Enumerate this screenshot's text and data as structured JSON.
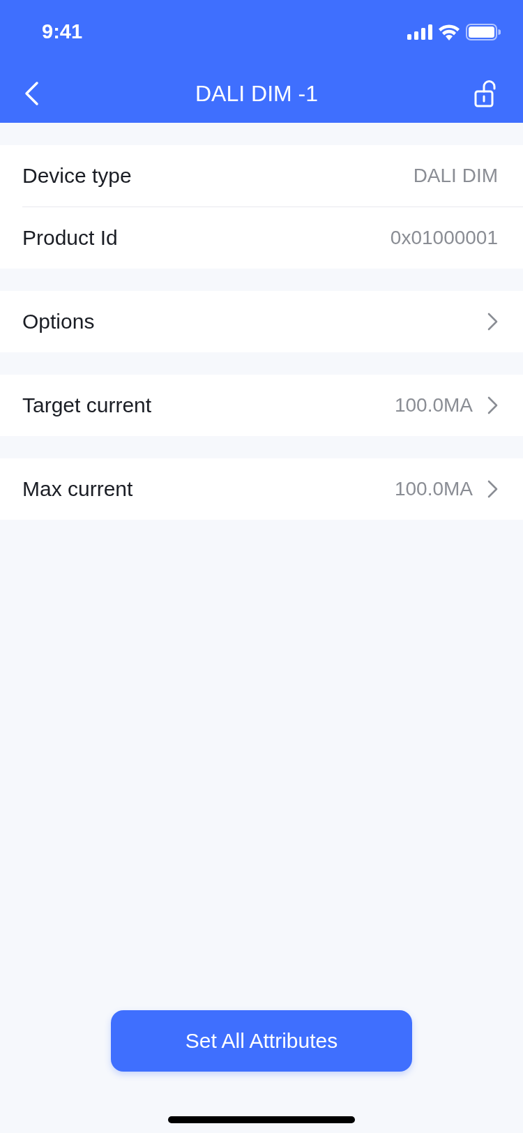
{
  "status_bar": {
    "time": "9:41"
  },
  "nav_bar": {
    "title": "DALI DIM -1"
  },
  "sections": [
    {
      "rows": [
        {
          "kind": "info",
          "label": "Device type",
          "value": "DALI DIM"
        },
        {
          "kind": "info",
          "label": "Product Id",
          "value": "0x01000001"
        }
      ]
    },
    {
      "rows": [
        {
          "kind": "nav",
          "label": "Options"
        }
      ]
    },
    {
      "rows": [
        {
          "kind": "nav",
          "label": "Target current",
          "value": "100.0MA"
        }
      ]
    },
    {
      "rows": [
        {
          "kind": "nav",
          "label": "Max current",
          "value": "100.0MA"
        }
      ]
    }
  ],
  "primary_button": {
    "label": "Set All Attributes"
  }
}
